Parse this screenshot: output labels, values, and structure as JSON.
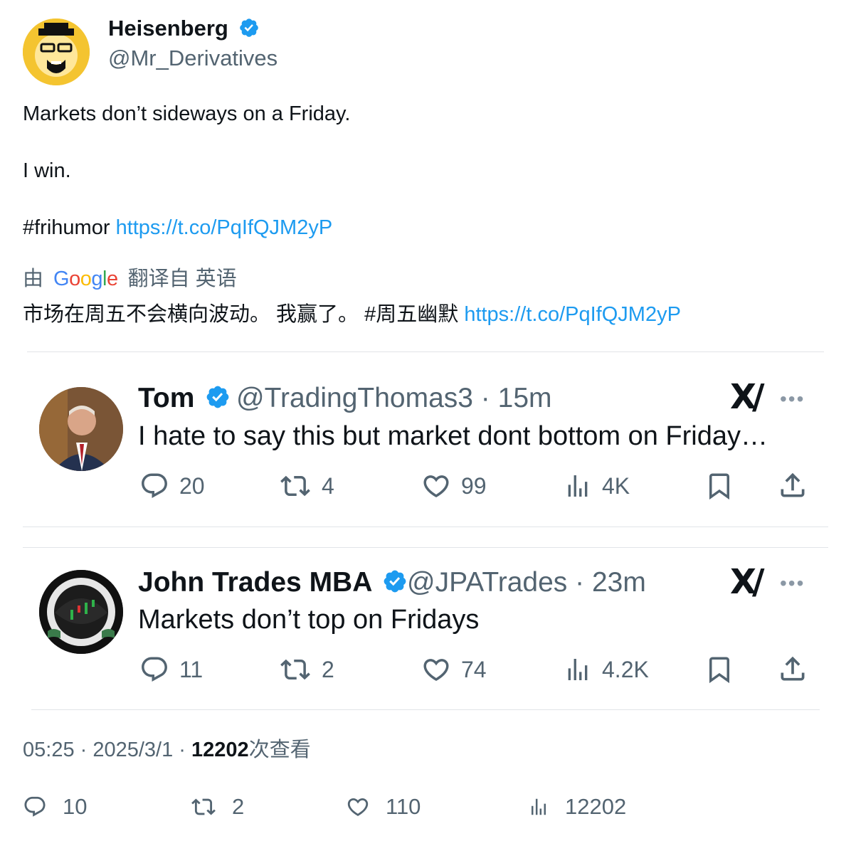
{
  "colors": {
    "link": "#1d9bf0",
    "verified": "#1d9bf0",
    "muted": "#536471",
    "text": "#0f1419"
  },
  "tweet": {
    "author_name": "Heisenberg",
    "author_handle": "@Mr_Derivatives",
    "line1": "Markets don’t sideways on a Friday.",
    "line2": "I win.",
    "hashtag": "#frihumor",
    "link": "https://t.co/PqIfQJM2yP"
  },
  "translation": {
    "prefix": "由",
    "google": [
      "G",
      "o",
      "o",
      "g",
      "l",
      "e"
    ],
    "suffix": "翻译自 英语",
    "text": "市场在周五不会横向波动。 我赢了。 #周五幽默",
    "link": "https://t.co/PqIfQJM2yP"
  },
  "embedded": [
    {
      "name": "Tom",
      "handle": "@TradingThomas3",
      "time": "15m",
      "text": "I hate to say this but market dont bottom on Friday…",
      "replies": "20",
      "reposts": "4",
      "likes": "99",
      "views": "4K"
    },
    {
      "name": "John Trades MBA",
      "handle": "@JPATrades",
      "time": "23m",
      "text": "Markets don’t top on Fridays",
      "replies": "11",
      "reposts": "2",
      "likes": "74",
      "views": "4.2K"
    }
  ],
  "footer": {
    "time": "05:25",
    "date": "2025/3/1",
    "views_count": "12202",
    "views_label": "次查看",
    "replies": "10",
    "reposts": "2",
    "likes": "110",
    "views": "12202"
  },
  "icons": [
    "verified-badge-icon",
    "reply-icon",
    "repost-icon",
    "like-icon",
    "views-icon",
    "bookmark-icon",
    "share-icon",
    "x-logo-icon",
    "more-icon"
  ]
}
